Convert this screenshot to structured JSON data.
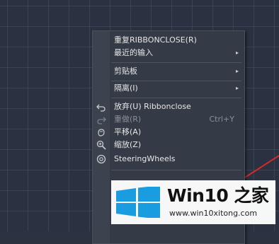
{
  "menu": {
    "items": [
      {
        "label": "重复RIBBONCLOSE(R)"
      },
      {
        "label": "最近的输入",
        "submenu": true
      },
      {
        "label": "剪贴板",
        "submenu": true
      },
      {
        "label": "隔离(I)",
        "submenu": true
      },
      {
        "label": "放弃(U) Ribbonclose",
        "icon": "undo-icon"
      },
      {
        "label": "重做(R)",
        "shortcut": "Ctrl+Y",
        "disabled": true,
        "icon": "redo-icon"
      },
      {
        "label": "平移(A)",
        "icon": "pan-icon"
      },
      {
        "label": "缩放(Z)",
        "icon": "zoom-icon"
      },
      {
        "label": "SteeringWheels",
        "icon": "steering-wheel-icon"
      }
    ],
    "submenu_glyph": "▸"
  },
  "watermark": {
    "title": "Win10 之家",
    "url": "www.win10xitong.com"
  },
  "colors": {
    "canvas_bg": "#2a3140",
    "menu_bg": "#353b46",
    "drawing_line": "#d42a2a",
    "win_logo": "#1a9ce0"
  }
}
